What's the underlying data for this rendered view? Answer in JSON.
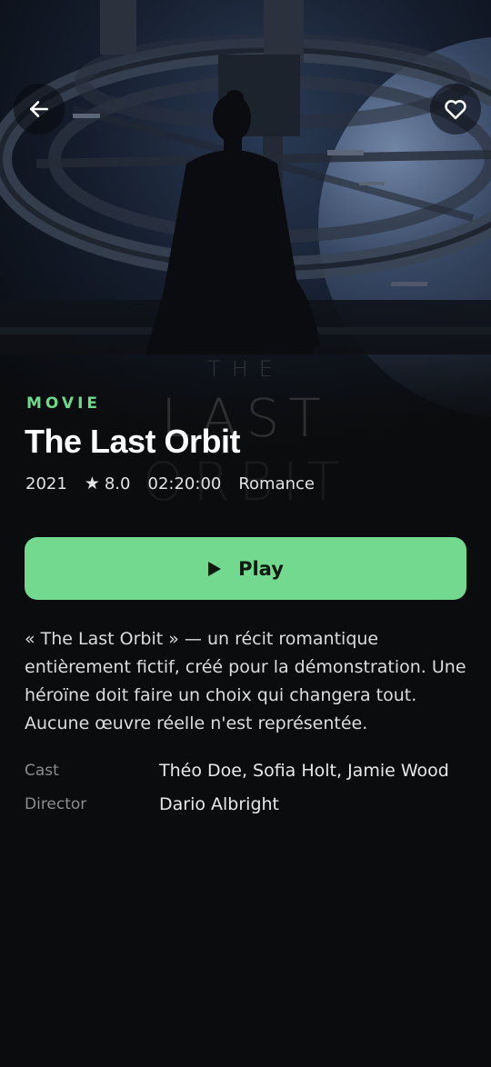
{
  "movie": {
    "type_label": "MOVIE",
    "title": "The Last Orbit",
    "year": "2021",
    "rating": "8.0",
    "duration": "02:20:00",
    "genre": "Romance",
    "description": "« The Last Orbit » — un récit romantique entièrement fictif, créé pour la démonstration. Une héroïne doit faire un choix qui changera tout. Aucune œuvre réelle n'est représentée."
  },
  "poster": {
    "line1": "THE",
    "line2": "LAST",
    "line3": "ORBIT"
  },
  "actions": {
    "play_label": "Play",
    "back_icon": "arrow-left-icon",
    "favorite_icon": "heart-icon",
    "play_icon": "play-icon"
  },
  "credits": [
    {
      "label": "Cast",
      "value": "Théo Doe, Sofia Holt, Jamie Wood"
    },
    {
      "label": "Director",
      "value": "Dario Albright"
    }
  ],
  "colors": {
    "accent": "#72d98f",
    "accent_text": "#6fd98b",
    "background": "#0b0c0d"
  }
}
